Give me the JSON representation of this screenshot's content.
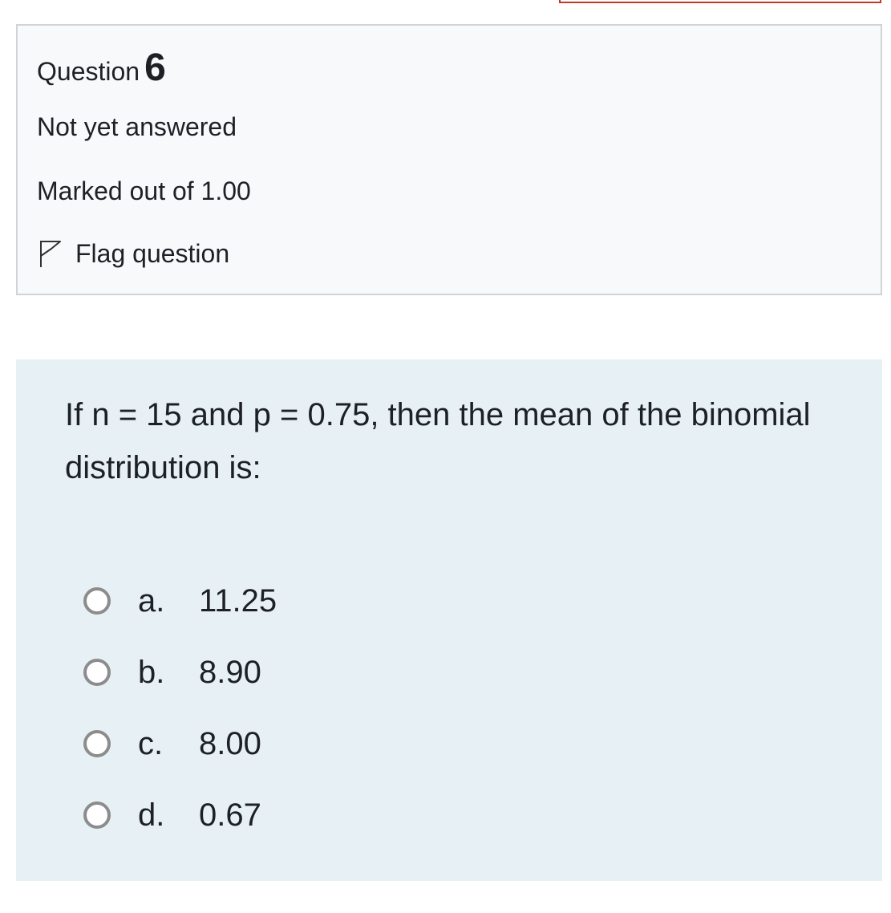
{
  "question": {
    "label": "Question",
    "number": "6",
    "state": "Not yet answered",
    "grade": "Marked out of 1.00",
    "flag_label": "Flag question",
    "flag_icon": "flag-outline-icon"
  },
  "content": {
    "text": "If n = 15 and p = 0.75, then the mean of the binomial distribution is:",
    "options": [
      {
        "letter": "a.",
        "value": "11.25"
      },
      {
        "letter": "b.",
        "value": "8.90"
      },
      {
        "letter": "c.",
        "value": "8.00"
      },
      {
        "letter": "d.",
        "value": "0.67"
      }
    ]
  },
  "colors": {
    "info_bg": "#f8f9fa",
    "info_border": "#ced4da",
    "content_bg": "#e7f1f5",
    "radio_border": "#8c8c8c",
    "accent_strip": "#c0392b"
  }
}
